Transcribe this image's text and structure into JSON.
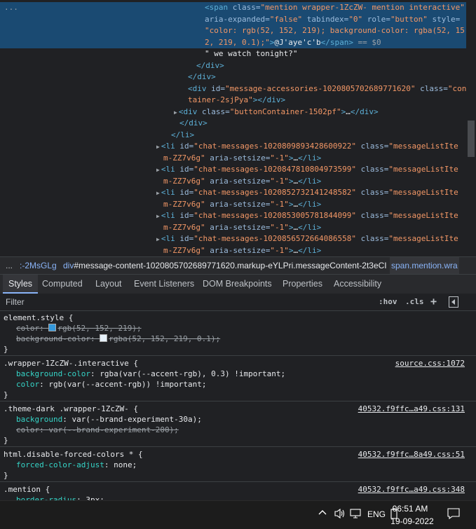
{
  "elements_tree": {
    "lines": [
      {
        "indent": "",
        "parts": [
          [
            "tag",
            "<span "
          ],
          [
            "attr",
            "class="
          ],
          [
            "val",
            "\"mention wrapper-1ZcZW- mention interactive\""
          ]
        ],
        "selected": true,
        "lead": "..."
      },
      {
        "indent": "",
        "parts": [
          [
            "attr",
            "aria-expanded="
          ],
          [
            "val",
            "\"false\""
          ],
          [
            "attr",
            " tabindex="
          ],
          [
            "val",
            "\"0\""
          ],
          [
            "attr",
            " role="
          ],
          [
            "val",
            "\"button\""
          ],
          [
            "attr",
            " style="
          ]
        ],
        "selected": true
      },
      {
        "indent": "",
        "parts": [
          [
            "val",
            "\"color: rgb(52, 152, 219); background-color: rgba(52, 15"
          ]
        ],
        "selected": true
      },
      {
        "indent": "",
        "parts": [
          [
            "val",
            "2, 219, 0.1);\""
          ],
          [
            "tag",
            ">"
          ],
          [
            "txt",
            "@J'aye'c'b"
          ],
          [
            "tag",
            "</span>"
          ],
          [
            "dim",
            " == $0"
          ]
        ],
        "selected": true
      },
      {
        "indent": "",
        "parts": [
          [
            "txt",
            "\" we watch tonight?\""
          ]
        ]
      },
      {
        "indent": "",
        "parts": [
          [
            "tag",
            "</div>"
          ]
        ]
      },
      {
        "indent": "",
        "parts": [
          [
            "tag",
            "</div>"
          ]
        ]
      },
      {
        "indent": "",
        "parts": [
          [
            "tag",
            "<div "
          ],
          [
            "attr",
            "id="
          ],
          [
            "val",
            "\"message-accessories-1020805702689771620\""
          ],
          [
            "attr",
            " class="
          ],
          [
            "val",
            "\"con"
          ]
        ]
      },
      {
        "indent": "",
        "parts": [
          [
            "val",
            "tainer-2sjPya\""
          ],
          [
            "tag",
            "></div>"
          ]
        ]
      },
      {
        "indent": "",
        "parts": [
          [
            "arrow",
            "▶"
          ],
          [
            "tag",
            "<div "
          ],
          [
            "attr",
            "class="
          ],
          [
            "val",
            "\"buttonContainer-1502pf\""
          ],
          [
            "tag",
            ">"
          ],
          [
            "txt",
            "…"
          ],
          [
            "tag",
            "</div>"
          ]
        ]
      },
      {
        "indent": "",
        "parts": [
          [
            "tag",
            "</div>"
          ]
        ]
      },
      {
        "indent": "",
        "parts": [
          [
            "tag",
            "</li>"
          ]
        ]
      },
      {
        "indent": "",
        "parts": [
          [
            "arrow",
            "▶"
          ],
          [
            "tag",
            "<li "
          ],
          [
            "attr",
            "id="
          ],
          [
            "val",
            "\"chat-messages-1020809893428600922\""
          ],
          [
            "attr",
            " class="
          ],
          [
            "val",
            "\"messageListIte"
          ]
        ]
      },
      {
        "indent": "",
        "parts": [
          [
            "val",
            "m-ZZ7v6g\""
          ],
          [
            "attr",
            " aria-setsize="
          ],
          [
            "val",
            "\"-1\""
          ],
          [
            "tag",
            ">"
          ],
          [
            "txt",
            "…"
          ],
          [
            "tag",
            "</li>"
          ]
        ]
      },
      {
        "indent": "",
        "parts": [
          [
            "arrow",
            "▶"
          ],
          [
            "tag",
            "<li "
          ],
          [
            "attr",
            "id="
          ],
          [
            "val",
            "\"chat-messages-1020847810804973599\""
          ],
          [
            "attr",
            " class="
          ],
          [
            "val",
            "\"messageListIte"
          ]
        ]
      },
      {
        "indent": "",
        "parts": [
          [
            "val",
            "m-ZZ7v6g\""
          ],
          [
            "attr",
            " aria-setsize="
          ],
          [
            "val",
            "\"-1\""
          ],
          [
            "tag",
            ">"
          ],
          [
            "txt",
            "…"
          ],
          [
            "tag",
            "</li>"
          ]
        ]
      },
      {
        "indent": "",
        "parts": [
          [
            "arrow",
            "▶"
          ],
          [
            "tag",
            "<li "
          ],
          [
            "attr",
            "id="
          ],
          [
            "val",
            "\"chat-messages-1020852732141248582\""
          ],
          [
            "attr",
            " class="
          ],
          [
            "val",
            "\"messageListIte"
          ]
        ]
      },
      {
        "indent": "",
        "parts": [
          [
            "val",
            "m-ZZ7v6g\""
          ],
          [
            "attr",
            " aria-setsize="
          ],
          [
            "val",
            "\"-1\""
          ],
          [
            "tag",
            ">"
          ],
          [
            "txt",
            "…"
          ],
          [
            "tag",
            "</li>"
          ]
        ]
      },
      {
        "indent": "",
        "parts": [
          [
            "arrow",
            "▶"
          ],
          [
            "tag",
            "<li "
          ],
          [
            "attr",
            "id="
          ],
          [
            "val",
            "\"chat-messages-1020853005781844099\""
          ],
          [
            "attr",
            " class="
          ],
          [
            "val",
            "\"messageListIte"
          ]
        ]
      },
      {
        "indent": "",
        "parts": [
          [
            "val",
            "m-ZZ7v6g\""
          ],
          [
            "attr",
            " aria-setsize="
          ],
          [
            "val",
            "\"-1\""
          ],
          [
            "tag",
            ">"
          ],
          [
            "txt",
            "…"
          ],
          [
            "tag",
            "</li>"
          ]
        ]
      },
      {
        "indent": "",
        "parts": [
          [
            "arrow",
            "▶"
          ],
          [
            "tag",
            "<li "
          ],
          [
            "attr",
            "id="
          ],
          [
            "val",
            "\"chat-messages-1020856572664086558\""
          ],
          [
            "attr",
            " class="
          ],
          [
            "val",
            "\"messageListIte"
          ]
        ]
      },
      {
        "indent": "",
        "parts": [
          [
            "val",
            "m-ZZ7v6g\""
          ],
          [
            "attr",
            " aria-setsize="
          ],
          [
            "val",
            "\"-1\""
          ],
          [
            "tag",
            ">"
          ],
          [
            "txt",
            "…"
          ],
          [
            "tag",
            "</li>"
          ]
        ]
      }
    ]
  },
  "breadcrumb": {
    "more": "...",
    "item1": ":-2MsGLg",
    "item2": "div#message-content-1020805702689771620.markup-eYLPri.messageContent-2t3eCI",
    "item3": "span.mention.wra"
  },
  "tabs": [
    "Styles",
    "Computed",
    "Layout",
    "Event Listeners",
    "DOM Breakpoints",
    "Properties",
    "Accessibility"
  ],
  "filter": {
    "placeholder": "Filter",
    "hov": ":hov",
    "cls": ".cls",
    "plus": "+"
  },
  "styles": {
    "rules": [
      {
        "selector": "element.style {",
        "source": "",
        "decls": [
          {
            "prop": "color",
            "value": "rgb(52, 152, 219);",
            "struck": true,
            "swatch": "#3498db"
          },
          {
            "prop": "background-color",
            "value": "rgba(52, 152, 219, 0.1);",
            "struck": true,
            "swatch": "#e6f1fa"
          }
        ]
      },
      {
        "selector": ".wrapper-1ZcZW-.interactive {",
        "source": "source.css:1072",
        "decls": [
          {
            "prop": "background-color",
            "value": "rgba(var(--accent-rgb), 0.3) !important;",
            "struck": false
          },
          {
            "prop": "color",
            "value": "rgb(var(--accent-rgb)) !important;",
            "struck": false
          }
        ]
      },
      {
        "selector": ".theme-dark .wrapper-1ZcZW- {",
        "source": "40532.f9ffc…a49.css:131",
        "decls": [
          {
            "prop": "background",
            "value": "var(--brand-experiment-30a);",
            "struck": false
          },
          {
            "prop": "color",
            "value": "var(--brand-experiment-200);",
            "struck": true
          }
        ]
      },
      {
        "selector": "html.disable-forced-colors * {",
        "source": "40532.f9ffc…8a49.css:51",
        "decls": [
          {
            "prop": "forced-color-adjust",
            "value": "none;",
            "struck": false
          }
        ]
      },
      {
        "selector": ".mention {",
        "source": "40532.f9ffc…a49.css:348",
        "decls": [
          {
            "prop": "border-radius",
            "value": "3px;",
            "struck": false
          }
        ]
      }
    ],
    "close_brace": "}"
  },
  "taskbar": {
    "time": "06:51 AM",
    "date": "19-09-2022",
    "lang": "ENG",
    "icons": [
      "chevron-up-icon",
      "volume-icon",
      "network-icon",
      "battery-icon",
      "notification-icon"
    ]
  }
}
